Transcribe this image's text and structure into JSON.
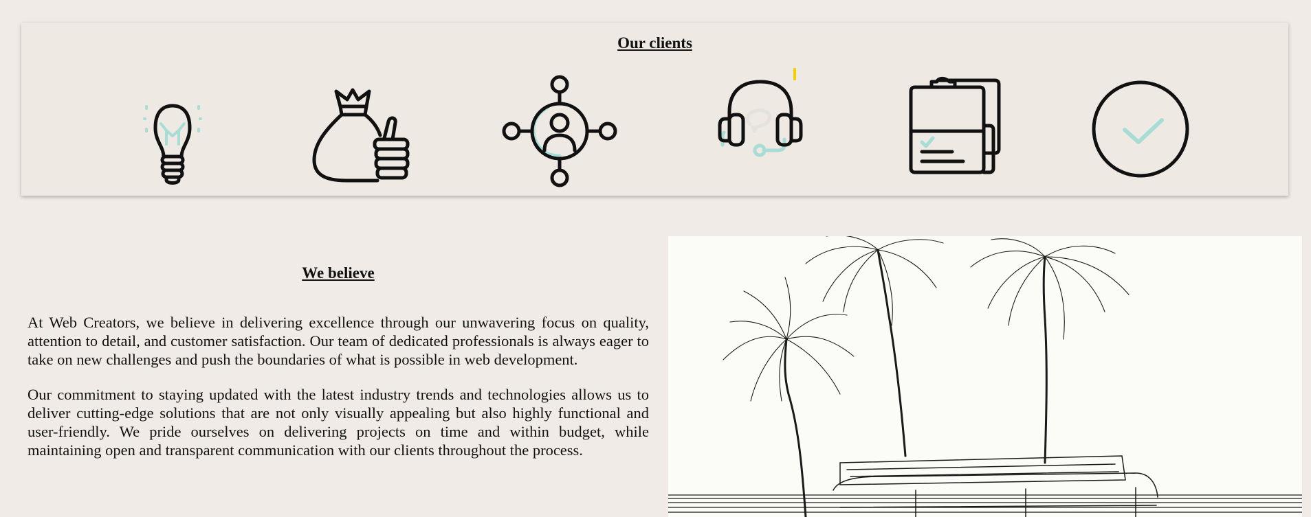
{
  "clients": {
    "title": "Our clients",
    "icons": [
      "lightbulb-icon",
      "money-bag-thumbs-up-icon",
      "network-person-icon",
      "headset-support-icon",
      "clipboard-checklist-icon",
      "check-circle-icon"
    ],
    "accent_color": "#a8ddd5",
    "stroke_color": "#111111"
  },
  "believe": {
    "title": "We believe",
    "paragraphs": [
      "At Web Creators, we believe in delivering excellence through our unwavering focus on quality, attention to detail, and customer satisfaction. Our team of dedicated professionals is always eager to take on new challenges and push the boundaries of what is possible in web development.",
      "Our commitment to staying updated with the latest industry trends and technologies allows us to deliver cutting-edge solutions that are not only visually appealing but also highly functional and user-friendly. We pride ourselves on delivering projects on time and within budget, while maintaining open and transparent communication with our clients throughout the process."
    ]
  },
  "photo": {
    "subject": "palm-trees-van-sketch"
  }
}
